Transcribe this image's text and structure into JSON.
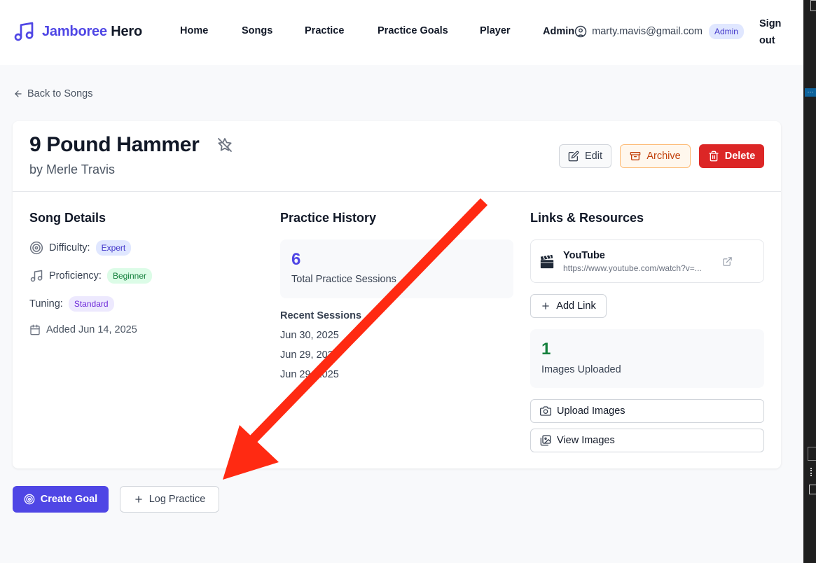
{
  "header": {
    "brand_prefix": "Jamboree",
    "brand_suffix": "Hero",
    "nav": [
      "Home",
      "Songs",
      "Practice",
      "Practice Goals",
      "Player",
      "Admin"
    ],
    "user_email": "marty.mavis@gmail.com",
    "role_badge": "Admin",
    "sign_out": "Sign out"
  },
  "back_link": "Back to Songs",
  "song": {
    "title": "9 Pound Hammer",
    "artist": "by Merle Travis"
  },
  "actions": {
    "edit": "Edit",
    "archive": "Archive",
    "delete": "Delete"
  },
  "details": {
    "title": "Song Details",
    "difficulty_label": "Difficulty:",
    "difficulty_value": "Expert",
    "proficiency_label": "Proficiency:",
    "proficiency_value": "Beginner",
    "tuning_label": "Tuning:",
    "tuning_value": "Standard",
    "added": "Added Jun 14, 2025"
  },
  "practice": {
    "title": "Practice History",
    "total_count": "6",
    "total_label": "Total Practice Sessions",
    "recent_title": "Recent Sessions",
    "recent": [
      "Jun 30, 2025",
      "Jun 29, 2025",
      "Jun 29, 2025"
    ]
  },
  "resources": {
    "title": "Links & Resources",
    "link_title": "YouTube",
    "link_url": "https://www.youtube.com/watch?v=...",
    "add_link": "Add Link",
    "images_count": "1",
    "images_label": "Images Uploaded",
    "upload_images": "Upload Images",
    "view_images": "View Images"
  },
  "bottom": {
    "create_goal": "Create Goal",
    "log_practice": "Log Practice"
  },
  "colors": {
    "accent": "#4f46e5",
    "danger": "#dc2626",
    "annotation_arrow": "#ff2a12",
    "success": "#15803d"
  }
}
